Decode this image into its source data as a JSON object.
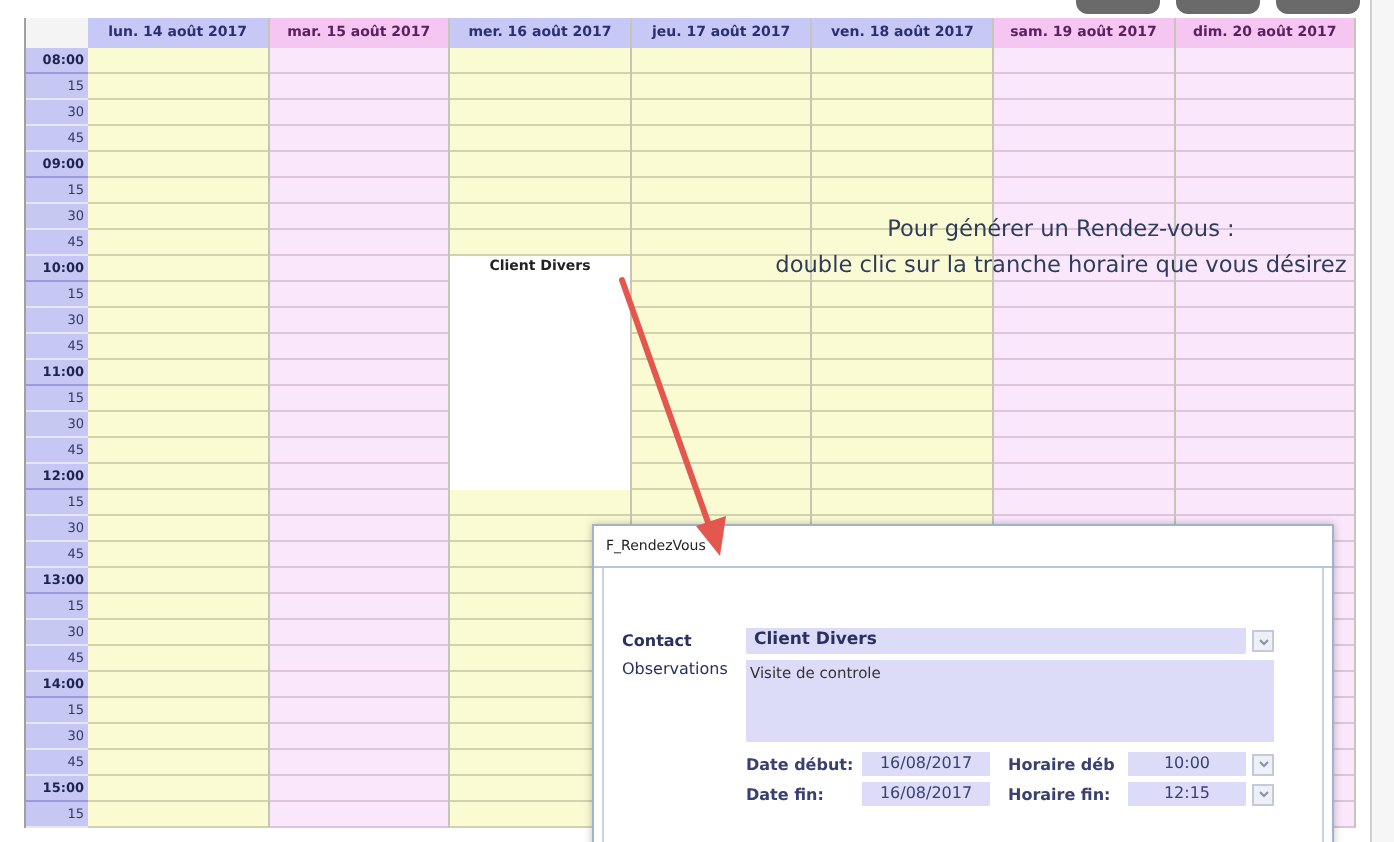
{
  "toolbar_buttons": [
    {
      "kind": "cut"
    },
    {
      "kind": "cut"
    },
    {
      "kind": "cut"
    }
  ],
  "days": [
    {
      "label": "lun. 14 août 2017",
      "highlighted": false
    },
    {
      "label": "mar. 15 août 2017",
      "highlighted": true
    },
    {
      "label": "mer. 16 août 2017",
      "highlighted": false,
      "events": [
        {
          "title": "Client Divers"
        }
      ]
    },
    {
      "label": "jeu. 17 août 2017",
      "highlighted": false
    },
    {
      "label": "ven. 18 août 2017",
      "highlighted": false
    },
    {
      "label": "sam. 19 août 2017",
      "highlighted": true
    },
    {
      "label": "dim. 20 août 2017",
      "highlighted": true
    }
  ],
  "times": [
    {
      "label": "08:00",
      "kind": "hour"
    },
    {
      "label": "15",
      "kind": "quarter"
    },
    {
      "label": "30",
      "kind": "quarter"
    },
    {
      "label": "45",
      "kind": "quarter"
    },
    {
      "label": "09:00",
      "kind": "hour"
    },
    {
      "label": "15",
      "kind": "quarter"
    },
    {
      "label": "30",
      "kind": "quarter"
    },
    {
      "label": "45",
      "kind": "quarter"
    },
    {
      "label": "10:00",
      "kind": "hour"
    },
    {
      "label": "15",
      "kind": "quarter"
    },
    {
      "label": "30",
      "kind": "quarter"
    },
    {
      "label": "45",
      "kind": "quarter"
    },
    {
      "label": "11:00",
      "kind": "hour"
    },
    {
      "label": "15",
      "kind": "quarter"
    },
    {
      "label": "30",
      "kind": "quarter"
    },
    {
      "label": "45",
      "kind": "quarter"
    },
    {
      "label": "12:00",
      "kind": "hour"
    },
    {
      "label": "15",
      "kind": "quarter"
    },
    {
      "label": "30",
      "kind": "quarter"
    },
    {
      "label": "45",
      "kind": "quarter"
    },
    {
      "label": "13:00",
      "kind": "hour"
    },
    {
      "label": "15",
      "kind": "quarter"
    },
    {
      "label": "30",
      "kind": "quarter"
    },
    {
      "label": "45",
      "kind": "quarter"
    },
    {
      "label": "14:00",
      "kind": "hour"
    },
    {
      "label": "15",
      "kind": "quarter"
    },
    {
      "label": "30",
      "kind": "quarter"
    },
    {
      "label": "45",
      "kind": "quarter"
    },
    {
      "label": "15:00",
      "kind": "hour"
    },
    {
      "label": "15",
      "kind": "quarter"
    }
  ],
  "hint": [
    "Pour générer un Rendez-vous :",
    "double clic sur la tranche horaire que vous désirez"
  ],
  "dialog": {
    "title": "F_RendezVous",
    "contact": {
      "label": "Contact",
      "value": "Client Divers"
    },
    "observations": {
      "label": "Observations",
      "value": "Visite de controle"
    },
    "date_start": {
      "label": "Date début:",
      "value": "16/08/2017"
    },
    "time_start": {
      "label": "Horaire déb",
      "value": "10:00"
    },
    "date_end": {
      "label": "Date fin:",
      "value": "16/08/2017"
    },
    "time_end": {
      "label": "Horaire fin:",
      "value": "12:15"
    }
  }
}
